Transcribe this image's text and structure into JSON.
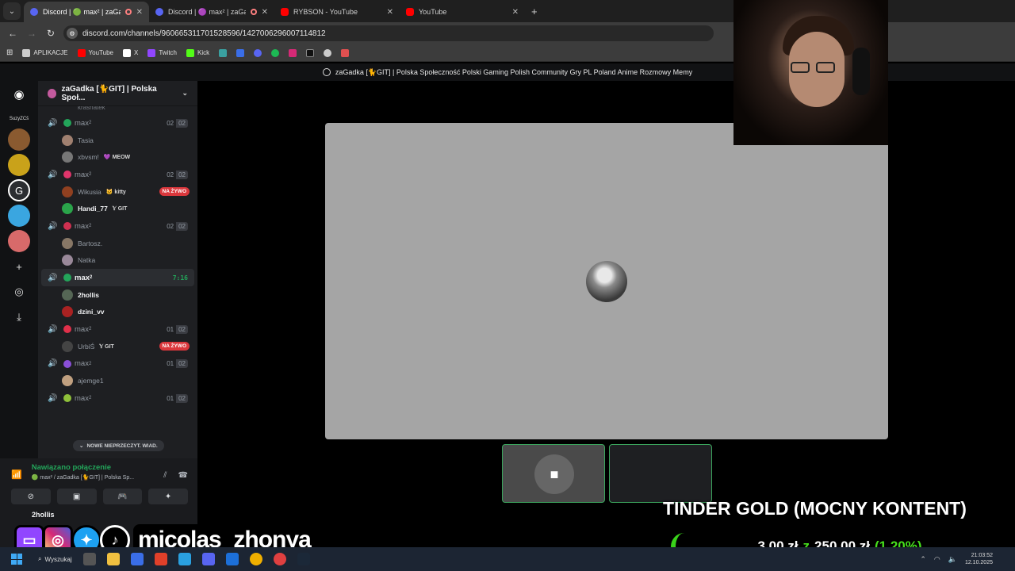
{
  "browser": {
    "tabs": [
      {
        "title": "Discord | 🟢 max² | zaGadk",
        "favicon": "discord",
        "recording": true,
        "active": true
      },
      {
        "title": "Discord | 🟣 max² | zaGadk",
        "favicon": "discord",
        "recording": true,
        "active": false
      },
      {
        "title": "RYBSON - YouTube",
        "favicon": "youtube",
        "recording": false,
        "active": false
      },
      {
        "title": "YouTube",
        "favicon": "youtube",
        "recording": false,
        "active": false
      }
    ],
    "new_tab": "+",
    "url": "discord.com/channels/960665311701528596/1427006296007114812",
    "bookmarks": [
      {
        "label": "APLIKACJE",
        "color": "#cccccc"
      },
      {
        "label": "YouTube",
        "color": "#ff0000"
      },
      {
        "label": "X",
        "color": "#ffffff"
      },
      {
        "label": "Twitch",
        "color": "#9146ff"
      },
      {
        "label": "Kick",
        "color": "#53fc18"
      }
    ]
  },
  "discord": {
    "window_title": "zaGadka [🐈GIT] | Polska Społeczność Polski Gaming Polish Community Gry PL Poland Anime Rozmowy Memy",
    "guild_label": "SuzyZCš",
    "server_name": "zaGadka [🐈GIT] | Polska Społ...",
    "cut_user": "krasnatek",
    "channels": [
      {
        "name": "max",
        "sup": "2",
        "icon_color": "#23a55a",
        "count": "02",
        "limit": "02",
        "active": false,
        "users": [
          {
            "name": "Tasia",
            "av": "#a08070"
          },
          {
            "name": "xbvsm!",
            "tag": "💜 MEOW",
            "av": "#777"
          }
        ]
      },
      {
        "name": "max",
        "sup": "2",
        "icon_color": "#e0356b",
        "count": "02",
        "limit": "02",
        "active": false,
        "users": [
          {
            "name": "Wikusia",
            "tag": "🐱 kitty",
            "av": "#904020",
            "live": "NA ŻYWO"
          },
          {
            "name": "Handi_77",
            "tag": "𝕐 GIT",
            "av": "#2aa44a",
            "bright": true
          }
        ]
      },
      {
        "name": "max",
        "sup": "2",
        "icon_color": "#d03050",
        "count": "02",
        "limit": "02",
        "active": false,
        "users": [
          {
            "name": "Bartosz.",
            "av": "#887766"
          },
          {
            "name": "Natka",
            "av": "#998899"
          }
        ]
      },
      {
        "name": "max",
        "sup": "2",
        "icon_color": "#23a55a",
        "timer": "7:16",
        "active": true,
        "users": [
          {
            "name": "2hollis",
            "av": "#556655",
            "bright": true
          },
          {
            "name": "dzini_vv",
            "av": "#aa2222",
            "bright": true
          }
        ]
      },
      {
        "name": "max",
        "sup": "2",
        "icon_color": "#e0304a",
        "count": "01",
        "limit": "02",
        "active": false,
        "users": [
          {
            "name": "UrbiŚ",
            "tag": "𝕐 GIT",
            "av": "#444",
            "live": "NA ŻYWO"
          }
        ]
      },
      {
        "name": "max",
        "sup": "2",
        "icon_color": "#8a4fd8",
        "count": "01",
        "limit": "02",
        "active": false,
        "users": [
          {
            "name": "ajemge1",
            "av": "#c0a080"
          }
        ]
      },
      {
        "name": "max",
        "sup": "2",
        "icon_color": "#8fc03a",
        "count": "01",
        "limit": "02",
        "active": false,
        "users": []
      }
    ],
    "new_messages": "NOWE NIEPRZECZYT. WIAD.",
    "voice": {
      "status": "Nawiązano połączenie",
      "location": "🟢 max² / zaGadka [🐈GIT] | Polska Sp..."
    },
    "current_user": "2hollis"
  },
  "overlay": {
    "donation_title": "TINDER GOLD (MOCNY KONTENT)",
    "goal_current": "3,00 zł",
    "goal_sep": "z",
    "goal_target": "250,00 zł",
    "goal_pct": "(1.20%)",
    "goal_progress": 0.012,
    "social_handle": "micolas_zhonya"
  },
  "taskbar": {
    "search": "Wyszukaj",
    "time": "21:03:52",
    "date": "12.10.2025"
  }
}
